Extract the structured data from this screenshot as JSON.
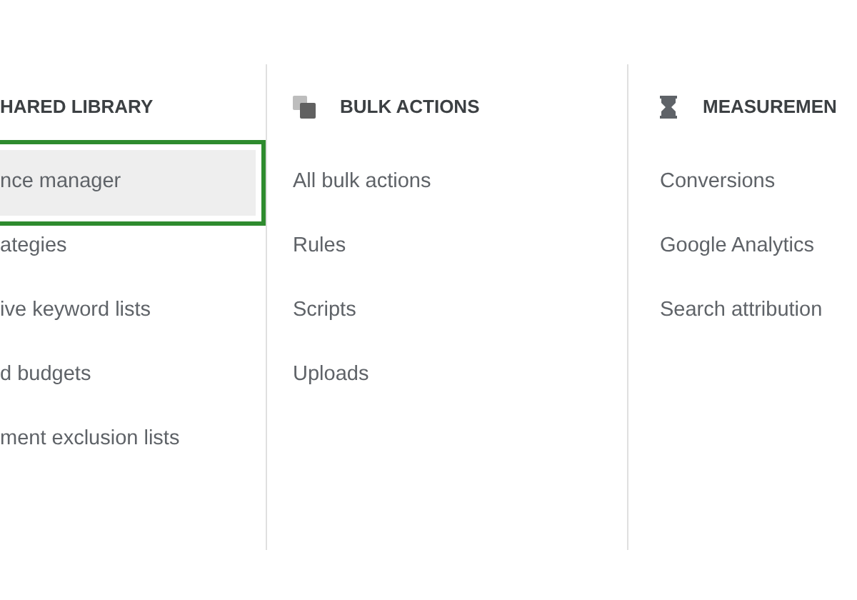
{
  "columns": [
    {
      "title": "HARED LIBRARY",
      "items": [
        {
          "label": "nce manager",
          "selected": true
        },
        {
          "label": "ategies",
          "selected": false
        },
        {
          "label": "ive keyword lists",
          "selected": false
        },
        {
          "label": "d budgets",
          "selected": false
        },
        {
          "label": "ment exclusion lists",
          "selected": false
        }
      ]
    },
    {
      "title": "BULK ACTIONS",
      "items": [
        {
          "label": "All bulk actions",
          "selected": false
        },
        {
          "label": "Rules",
          "selected": false
        },
        {
          "label": "Scripts",
          "selected": false
        },
        {
          "label": "Uploads",
          "selected": false
        }
      ]
    },
    {
      "title": "MEASUREMEN",
      "items": [
        {
          "label": "Conversions",
          "selected": false
        },
        {
          "label": "Google Analytics",
          "selected": false
        },
        {
          "label": "Search attribution",
          "selected": false
        }
      ]
    }
  ]
}
